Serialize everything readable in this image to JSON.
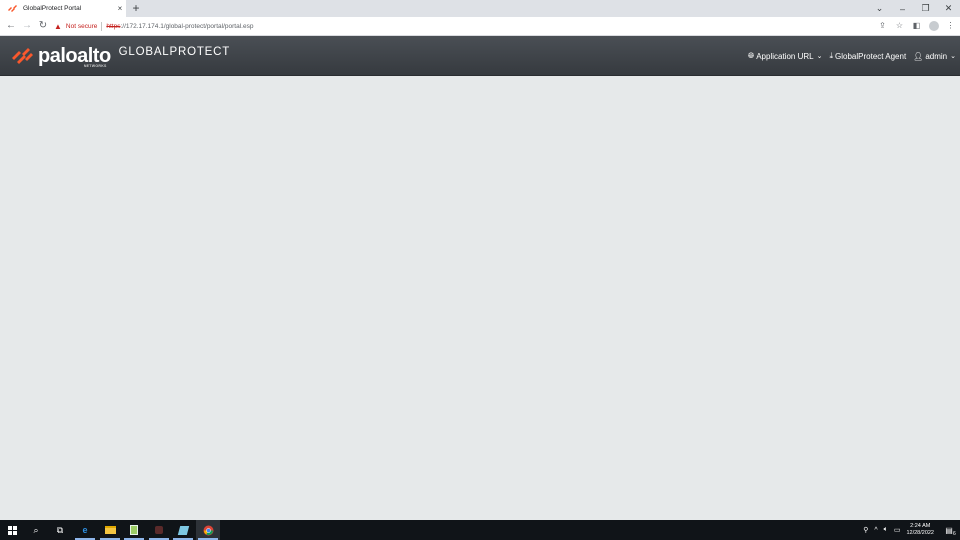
{
  "browser": {
    "tab_title": "GlobalProtect Portal",
    "tab_close": "×",
    "new_tab": "+",
    "window_controls": [
      "⌄",
      "–",
      "❐",
      "✕"
    ],
    "security_label": "Not secure",
    "url_scheme": "https",
    "url_rest": "://172.17.174.1/global-protect/portal/portal.esp"
  },
  "header": {
    "logo_text": "paloalto",
    "logo_subtext": "NETWORKS",
    "product_name": "GLOBALPROTECT",
    "menu": {
      "application_url": "Application URL",
      "agent": "GlobalProtect Agent",
      "user": "admin"
    }
  },
  "taskbar": {
    "time": "2:24 AM",
    "date": "12/28/2022",
    "notification_count": "6"
  },
  "colors": {
    "brand_orange": "#fa582d",
    "header_bg": "#3f4348",
    "content_bg": "#e6e9ea",
    "insecure_red": "#c5221f"
  }
}
